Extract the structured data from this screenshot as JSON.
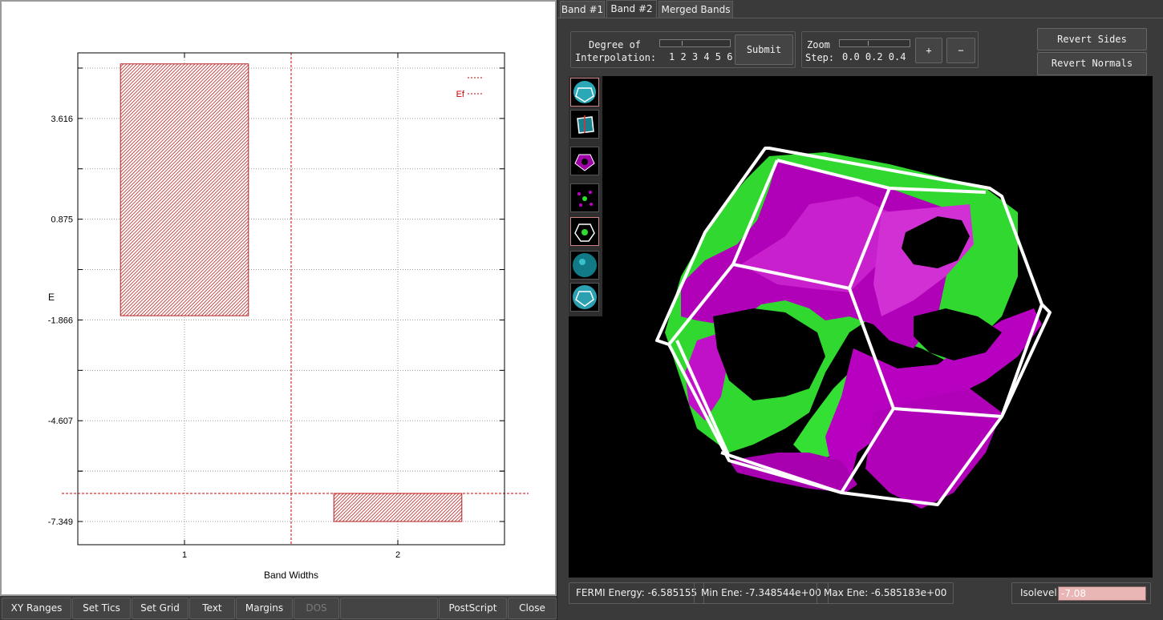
{
  "left_panel": {
    "toolbar": [
      {
        "label": "XY Ranges",
        "enabled": true
      },
      {
        "label": "Set Tics",
        "enabled": true
      },
      {
        "label": "Set Grid",
        "enabled": true
      },
      {
        "label": "Text",
        "enabled": true
      },
      {
        "label": "Margins",
        "enabled": true
      },
      {
        "label": "DOS",
        "enabled": false
      },
      {
        "label": "PostScript",
        "enabled": true
      },
      {
        "label": "Close",
        "enabled": true
      }
    ]
  },
  "chart_data": {
    "type": "bar",
    "xlabel": "Band Widths",
    "ylabel": "E",
    "categories": [
      "1",
      "2"
    ],
    "bands": [
      {
        "band": "1",
        "min": -1.75,
        "max": 5.1
      },
      {
        "band": "2",
        "min": -7.349,
        "max": -6.585
      }
    ],
    "yticks": [
      "3.616",
      "0.875",
      "-1.866",
      "-4.607",
      "-7.349"
    ],
    "ylim": [
      -7.98,
      5.4
    ],
    "fermi_energy": -6.585,
    "fermi_line_label": "Ef",
    "grid": true,
    "legend_position": "top-right",
    "colors": {
      "bar": "#b22222",
      "fermi": "#cc0000",
      "grid": "#9a9a9a"
    }
  },
  "right_panel": {
    "tabs": [
      {
        "label": "Band #1",
        "active": false
      },
      {
        "label": "Band #2",
        "active": true
      },
      {
        "label": "Merged Bands",
        "active": false
      }
    ],
    "interpolation": {
      "label_line1": "Degree of",
      "label_line2": "Interpolation:",
      "scale": "1 2 3 4 5 6",
      "submit_label": "Submit"
    },
    "zoom": {
      "label_line1": "Zoom",
      "label_line2": "Step:",
      "scale": "0.0 0.2 0.4",
      "plus_label": "+",
      "minus_label": "−"
    },
    "revert_sides_label": "Revert Sides",
    "revert_normals_label": "Revert Normals",
    "thumbnails": [
      "cell-full-view",
      "cell-axes-view",
      "cell-wire-magenta",
      "cell-dots-view",
      "cell-wire-green",
      "cell-sphere-view",
      "cell-solid-view"
    ],
    "status": {
      "fermi": "FERMI Energy: -6.585155",
      "min_ene": "Min Ene: -7.348544e+00",
      "max_ene": "Max Ene: -6.585183e+00",
      "isolevel_label": "Isolevel:",
      "isolevel_value": "-7.08"
    },
    "surface_colors": {
      "outer": "#c200c8",
      "inner": "#2ee02e",
      "frame": "#ffffff"
    }
  }
}
